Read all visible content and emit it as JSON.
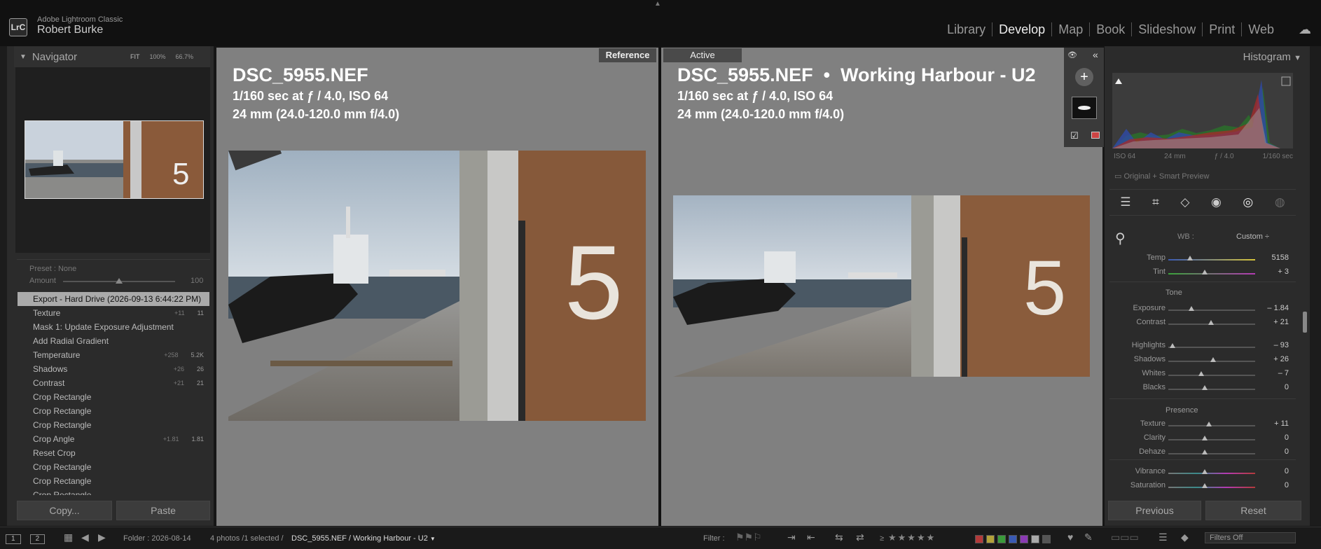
{
  "app": {
    "name": "Adobe Lightroom Classic",
    "logo": "LrC",
    "user": "Robert Burke"
  },
  "modules": [
    {
      "label": "Library",
      "active": false
    },
    {
      "label": "Develop",
      "active": true
    },
    {
      "label": "Map",
      "active": false
    },
    {
      "label": "Book",
      "active": false
    },
    {
      "label": "Slideshow",
      "active": false
    },
    {
      "label": "Print",
      "active": false
    },
    {
      "label": "Web",
      "active": false
    }
  ],
  "navigator": {
    "title": "Navigator",
    "zoom_fit": "FIT",
    "zoom_100": "100%",
    "zoom_custom": "66.7%"
  },
  "preset": {
    "label": "Preset :",
    "value": "None",
    "amount_label": "Amount",
    "amount_value": "100",
    "amount_fraction": 0.5
  },
  "history": [
    {
      "label": "Export - Hard Drive (2026-09-13 6:44:22 PM)",
      "selected": true,
      "delta": "",
      "value": ""
    },
    {
      "label": "Texture",
      "selected": false,
      "delta": "+11",
      "value": "11"
    },
    {
      "label": "Mask 1: Update Exposure Adjustment",
      "selected": false,
      "delta": "",
      "value": ""
    },
    {
      "label": "Add Radial Gradient",
      "selected": false,
      "delta": "",
      "value": ""
    },
    {
      "label": "Temperature",
      "selected": false,
      "delta": "+258",
      "value": "5.2K"
    },
    {
      "label": "Shadows",
      "selected": false,
      "delta": "+26",
      "value": "26"
    },
    {
      "label": "Contrast",
      "selected": false,
      "delta": "+21",
      "value": "21"
    },
    {
      "label": "Crop Rectangle",
      "selected": false,
      "delta": "",
      "value": ""
    },
    {
      "label": "Crop Rectangle",
      "selected": false,
      "delta": "",
      "value": ""
    },
    {
      "label": "Crop Rectangle",
      "selected": false,
      "delta": "",
      "value": ""
    },
    {
      "label": "Crop Angle",
      "selected": false,
      "delta": "+1.81",
      "value": "1.81"
    },
    {
      "label": "Reset Crop",
      "selected": false,
      "delta": "",
      "value": ""
    },
    {
      "label": "Crop Rectangle",
      "selected": false,
      "delta": "",
      "value": ""
    },
    {
      "label": "Crop Rectangle",
      "selected": false,
      "delta": "",
      "value": ""
    },
    {
      "label": "Crop Rectangle",
      "selected": false,
      "delta": "",
      "value": ""
    }
  ],
  "left_buttons": {
    "copy": "Copy...",
    "paste": "Paste"
  },
  "reference": {
    "label": "Reference",
    "filename": "DSC_5955.NEF",
    "exposure": "1/160 sec at ƒ / 4.0, ISO 64",
    "lens": "24 mm (24.0-120.0 mm f/4.0)"
  },
  "active": {
    "label": "Active",
    "filename": "DSC_5955.NEF  •  Working Harbour - U2",
    "exposure": "1/160 sec at ƒ / 4.0, ISO 64",
    "lens": "24 mm (24.0-120.0 mm f/4.0)"
  },
  "histogram": {
    "title": "Histogram",
    "iso": "ISO 64",
    "focal": "24 mm",
    "aperture": "ƒ / 4.0",
    "shutter": "1/160 sec",
    "preview": "Original + Smart Preview"
  },
  "wb": {
    "label": "WB :",
    "value": "Custom ÷"
  },
  "basic_sliders": [
    {
      "section": "",
      "label": "Temp",
      "value": "5158",
      "pos": 0.25,
      "color": "temp"
    },
    {
      "section": "",
      "label": "Tint",
      "value": "+ 3",
      "pos": 0.42,
      "color": "tint"
    },
    {
      "section": "Tone",
      "label": "Exposure",
      "value": "– 1.84",
      "pos": 0.27,
      "color": ""
    },
    {
      "section": "",
      "label": "Contrast",
      "value": "+ 21",
      "pos": 0.49,
      "color": ""
    },
    {
      "section": "",
      "label": "Highlights",
      "value": "– 93",
      "pos": 0.05,
      "color": ""
    },
    {
      "section": "",
      "label": "Shadows",
      "value": "+ 26",
      "pos": 0.52,
      "color": ""
    },
    {
      "section": "",
      "label": "Whites",
      "value": "– 7",
      "pos": 0.38,
      "color": ""
    },
    {
      "section": "",
      "label": "Blacks",
      "value": "0",
      "pos": 0.42,
      "color": ""
    },
    {
      "section": "Presence",
      "label": "Texture",
      "value": "+ 11",
      "pos": 0.47,
      "color": ""
    },
    {
      "section": "",
      "label": "Clarity",
      "value": "0",
      "pos": 0.42,
      "color": ""
    },
    {
      "section": "",
      "label": "Dehaze",
      "value": "0",
      "pos": 0.42,
      "color": ""
    },
    {
      "section": "",
      "label": "Vibrance",
      "value": "0",
      "pos": 0.42,
      "color": "vib"
    },
    {
      "section": "",
      "label": "Saturation",
      "value": "0",
      "pos": 0.42,
      "color": "vib"
    }
  ],
  "right_buttons": {
    "previous": "Previous",
    "reset": "Reset"
  },
  "bottom": {
    "screen1": "1",
    "screen2": "2",
    "folder": "Folder : 2026-08-14",
    "count": "4 photos /1 selected /",
    "path": "DSC_5955.NEF / Working Harbour - U2",
    "filter_label": "Filter :",
    "rating_op": "≥",
    "stars": "★★★★★",
    "filters_off": "Filters Off"
  },
  "label_colors": [
    "#b33a3a",
    "#b3a23a",
    "#3a9a3a",
    "#3a5ab3",
    "#8a3ab3",
    "#aaaaaa",
    "#555555"
  ]
}
